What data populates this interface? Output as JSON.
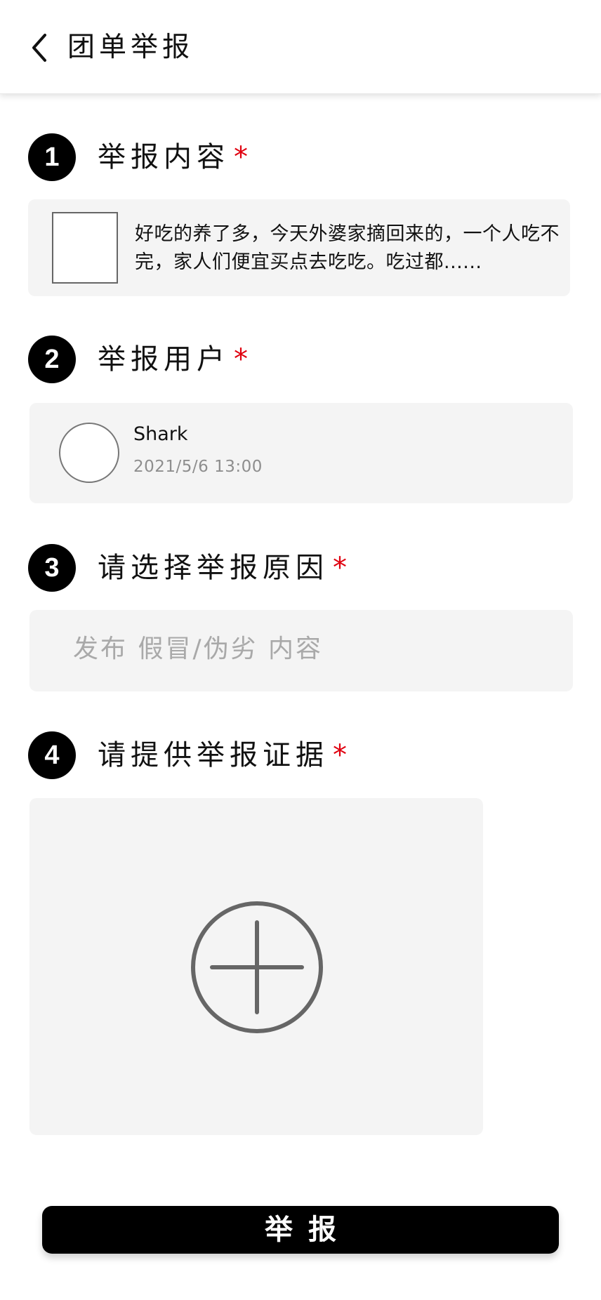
{
  "header": {
    "title": "团单举报"
  },
  "sections": [
    {
      "step": "1",
      "title": "举报内容",
      "required_mark": "*"
    },
    {
      "step": "2",
      "title": "举报用户",
      "required_mark": "*"
    },
    {
      "step": "3",
      "title": "请选择举报原因",
      "required_mark": "*"
    },
    {
      "step": "4",
      "title": "请提供举报证据",
      "required_mark": "*"
    }
  ],
  "content_card": {
    "text": "好吃的养了多，今天外婆家摘回来的，一个人吃不完，家人们便宜买点去吃吃。吃过都......"
  },
  "user_card": {
    "name": "Shark",
    "time": "2021/5/6  13:00"
  },
  "reason": {
    "value": "发布 假冒/伪劣 内容"
  },
  "submit": {
    "label": "举报"
  },
  "colors": {
    "accent": "#000000",
    "required": "#e0000f",
    "card_bg": "#f4f4f4"
  },
  "icons": {
    "back": "chevron-left-icon",
    "upload": "plus-circle-icon"
  }
}
